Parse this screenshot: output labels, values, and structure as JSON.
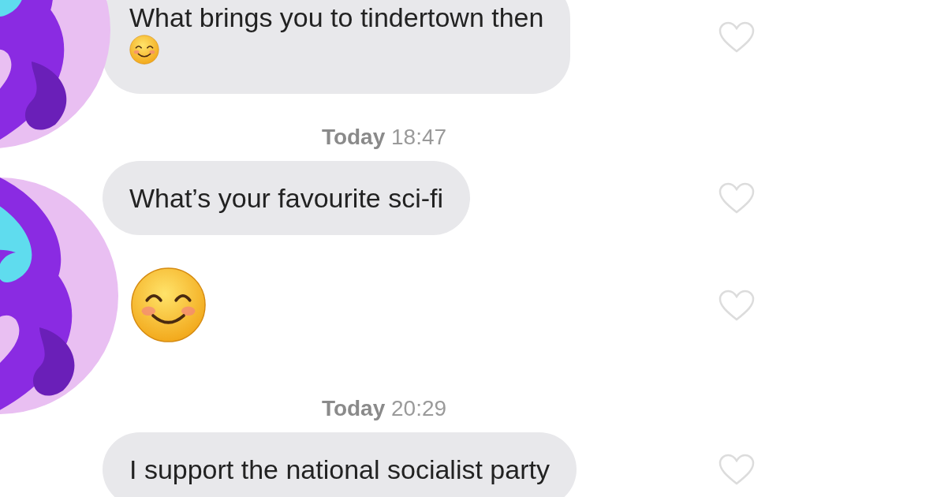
{
  "thread": [
    {
      "kind": "text",
      "text": "What brings you to tindertown then",
      "trailing_emoji": true,
      "liked": false
    },
    {
      "kind": "timestamp",
      "text": "**Today** 18:47"
    },
    {
      "kind": "text",
      "text": "What’s your favourite sci-fi",
      "trailing_emoji": false,
      "liked": false
    },
    {
      "kind": "emoji",
      "liked": false
    },
    {
      "kind": "timestamp",
      "text": "**Today** 20:29"
    },
    {
      "kind": "text",
      "text": "I support the national socialist party",
      "trailing_emoji": false,
      "liked": false
    }
  ]
}
